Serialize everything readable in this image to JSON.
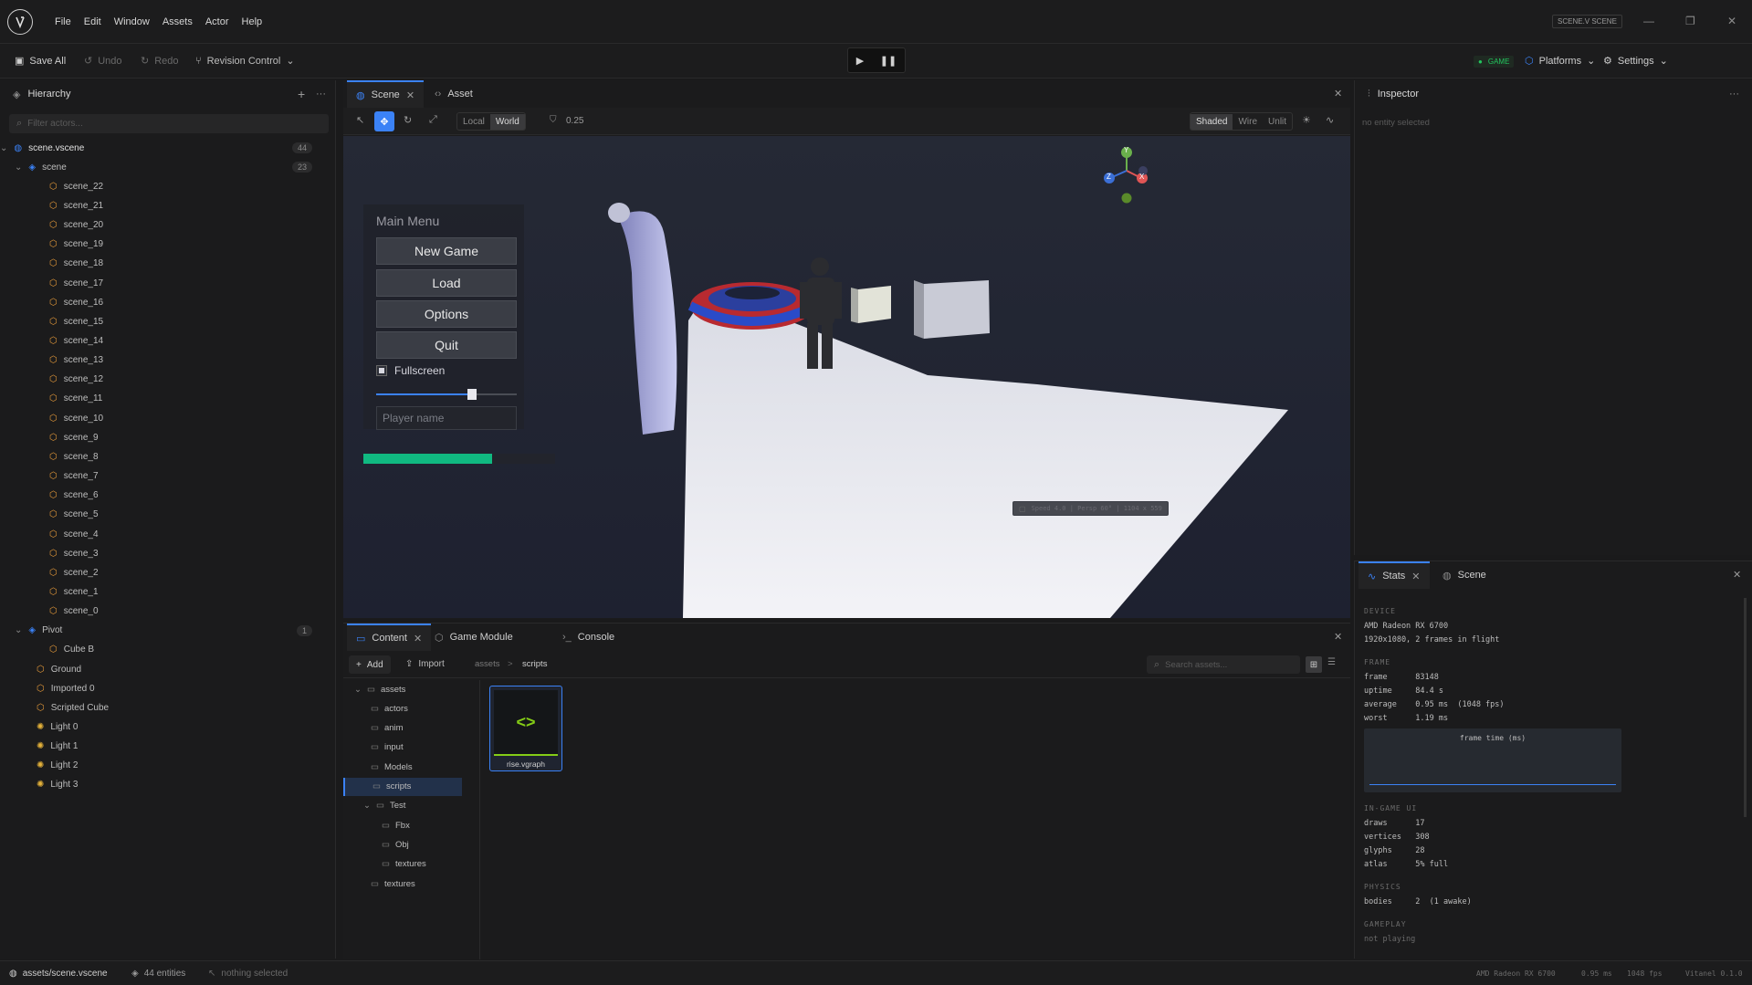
{
  "menu": [
    "File",
    "Edit",
    "Window",
    "Assets",
    "Actor",
    "Help"
  ],
  "scene_badge": "SCENE.V SCENE",
  "toolbar": {
    "save_all": "Save All",
    "undo": "Undo",
    "redo": "Redo",
    "revision": "Revision Control",
    "game_badge": "GAME",
    "platforms": "Platforms",
    "settings": "Settings"
  },
  "hierarchy": {
    "title": "Hierarchy",
    "filter_placeholder": "Filter actors...",
    "root": "scene.vscene",
    "root_count": "44",
    "scene": "scene",
    "scene_count": "23",
    "children": [
      "scene_22",
      "scene_21",
      "scene_20",
      "scene_19",
      "scene_18",
      "scene_17",
      "scene_16",
      "scene_15",
      "scene_14",
      "scene_13",
      "scene_12",
      "scene_11",
      "scene_10",
      "scene_9",
      "scene_8",
      "scene_7",
      "scene_6",
      "scene_5",
      "scene_4",
      "scene_3",
      "scene_2",
      "scene_1",
      "scene_0"
    ],
    "pivot": "Pivot",
    "pivot_count": "1",
    "pivot_child": "Cube B",
    "others": [
      "Ground",
      "Imported 0",
      "Scripted Cube"
    ],
    "lights": [
      "Light 0",
      "Light 1",
      "Light 2",
      "Light 3"
    ]
  },
  "viewport": {
    "tabs": [
      "Scene",
      "Asset"
    ],
    "local": "Local",
    "world": "World",
    "snap": "0.25",
    "shaded": "Shaded",
    "wire": "Wire",
    "unlit": "Unlit",
    "overlay": "Speed 4.0 | Persp 60° | 1104 x 559",
    "gizmo": {
      "y": "Y",
      "z": "Z",
      "x": "X"
    },
    "main_menu": {
      "title": "Main Menu",
      "buttons": [
        "New Game",
        "Load",
        "Options",
        "Quit"
      ],
      "fullscreen": "Fullscreen",
      "slider_value": 0.68,
      "player_placeholder": "Player name"
    },
    "progress_value": 0.67
  },
  "content": {
    "tabs": [
      "Content",
      "Game Module",
      "Console"
    ],
    "add": "Add",
    "import": "Import",
    "crumbs": [
      "assets",
      "scripts"
    ],
    "search_placeholder": "Search assets...",
    "tree": [
      "assets",
      "actors",
      "anim",
      "input",
      "Models",
      "scripts",
      "Test",
      "Fbx",
      "Obj",
      "textures",
      "textures"
    ],
    "asset_name": "rise.vgraph"
  },
  "inspector": {
    "title": "Inspector",
    "empty": "no entity selected"
  },
  "stats": {
    "tabs": [
      "Stats",
      "Scene"
    ],
    "device_h": "DEVICE",
    "gpu": "AMD Radeon RX 6700",
    "res": "1920x1080, 2 frames in flight",
    "frame_h": "FRAME",
    "frame": "frame      83148",
    "uptime": "uptime     84.4 s",
    "average": "average    0.95 ms  (1048 fps)",
    "worst": "worst      1.19 ms",
    "graph_title": "frame time (ms)",
    "ui_h": "IN-GAME UI",
    "draws": "draws      17",
    "vertices": "vertices   308",
    "glyphs": "glyphs     28",
    "atlas": "atlas      5% full",
    "physics_h": "PHYSICS",
    "bodies": "bodies     2  (1 awake)",
    "gameplay_h": "GAMEPLAY",
    "notplaying": "not playing"
  },
  "status": {
    "path": "assets/scene.vscene",
    "entities": "44 entities",
    "selection": "nothing selected",
    "gpu": "AMD Radeon RX 6700",
    "ms": "0.95 ms",
    "fps": "1048 fps",
    "version": "Vitanel 0.1.0"
  },
  "colors": {
    "accent": "#3b82f6",
    "progress": "#10b981",
    "game": "#22c55e"
  }
}
